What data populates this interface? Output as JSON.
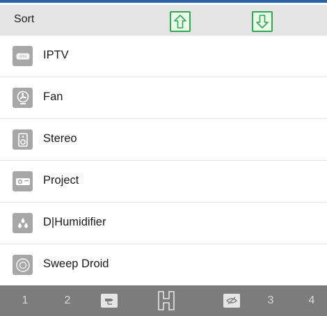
{
  "header": {
    "sort_label": "Sort",
    "move_up_icon": "arrow-up-icon",
    "move_down_icon": "arrow-down-icon",
    "accent_color": "#2fa84f"
  },
  "devices": [
    {
      "label": "IPTV",
      "icon": "iptv-icon"
    },
    {
      "label": "Fan",
      "icon": "fan-icon"
    },
    {
      "label": "Stereo",
      "icon": "speaker-icon"
    },
    {
      "label": "Project",
      "icon": "projector-icon"
    },
    {
      "label": "D|Humidifier",
      "icon": "humidifier-icon"
    },
    {
      "label": "Sweep Droid",
      "icon": "robot-vacuum-icon"
    }
  ],
  "bottom_bar": {
    "items": [
      {
        "label": "1"
      },
      {
        "label": "2"
      },
      {
        "icon": "camera-icon"
      },
      {
        "icon": "home-h-icon"
      },
      {
        "icon": "hidden-eye-icon"
      },
      {
        "label": "3"
      },
      {
        "label": "4"
      }
    ],
    "background": "#7c7c7c"
  }
}
